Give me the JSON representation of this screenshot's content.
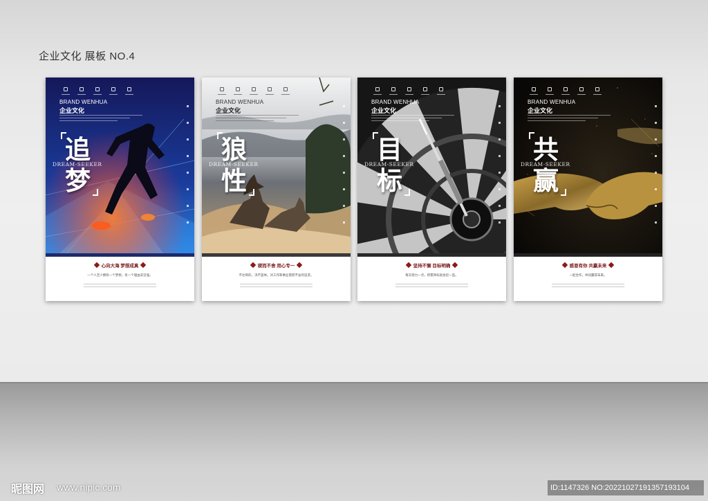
{
  "board_title": "企业文化 展板 NO.4",
  "watermark": {
    "logo": "昵图网",
    "url": "www.nipic.com",
    "id": "ID:1147326 NO:20221027191357193104"
  },
  "posters": [
    {
      "brand_en": "BRAND WENHUA",
      "brand_cn": "企业文化",
      "char1": "追",
      "char2": "梦",
      "seeker": "DREAM-SEEKER",
      "slogan": "心向大海 梦想成真",
      "desc": "一个人至少拥有一个梦想，有一个理由去坚强。",
      "band_color": "#1e2a6b"
    },
    {
      "brand_en": "BRAND WENHUA",
      "brand_cn": "企业文化",
      "char1": "狼",
      "char2": "性",
      "seeker": "DREAM-SEEKER",
      "slogan": "锲而不舍 用心专一",
      "desc": "不达目的，决不罢休。对工作和事业锲而不舍的追求。",
      "band_color": "#3a3a3a"
    },
    {
      "brand_en": "BRAND WENHUA",
      "brand_cn": "企业文化",
      "char1": "目",
      "char2": "标",
      "seeker": "DREAM-SEEKER",
      "slogan": "坚持不懈 目标明确",
      "desc": "每天努力一点，积累目标就会近一些。",
      "band_color": "#2a2a2a"
    },
    {
      "brand_en": "BRAND WENHUA",
      "brand_cn": "企业文化",
      "char1": "共",
      "char2": "赢",
      "seeker": "DREAM-SEEKER",
      "slogan": "感恩有你 共赢未来",
      "desc": "一起合作，共同赢得未来。",
      "band_color": "#222222"
    }
  ]
}
